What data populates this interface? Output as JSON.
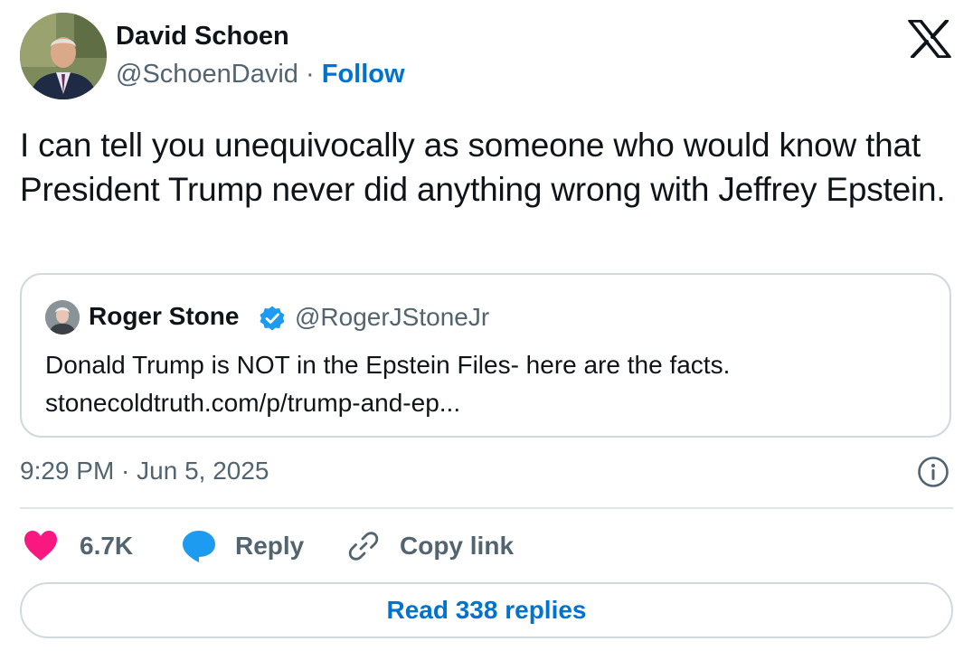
{
  "author": {
    "name": "David Schoen",
    "handle": "@SchoenDavid",
    "separator": "·",
    "follow_label": "Follow"
  },
  "tweet": {
    "text": "I can tell you unequivocally as someone who would know that President Trump never did anything wrong with Jeffrey Epstein."
  },
  "quoted_tweet": {
    "name": "Roger Stone",
    "verified": true,
    "handle": "@RogerJStoneJr",
    "text": "Donald Trump is NOT in the Epstein Files- here are the facts.",
    "link": "stonecoldtruth.com/p/trump-and-ep..."
  },
  "timestamp": "9:29 PM · Jun 5, 2025",
  "actions": {
    "likes": "6.7K",
    "reply_label": "Reply",
    "copy_link_label": "Copy link"
  },
  "read_replies_label": "Read 338 replies",
  "colors": {
    "link_blue": "#0073d1",
    "heart_pink": "#f91880",
    "reply_blue": "#1d9bf0",
    "verified_blue": "#1d9bf0",
    "secondary_text": "#536471"
  },
  "icons": [
    "x-logo-icon",
    "verified-badge-icon",
    "info-icon",
    "heart-icon",
    "reply-bubble-icon",
    "link-icon"
  ]
}
